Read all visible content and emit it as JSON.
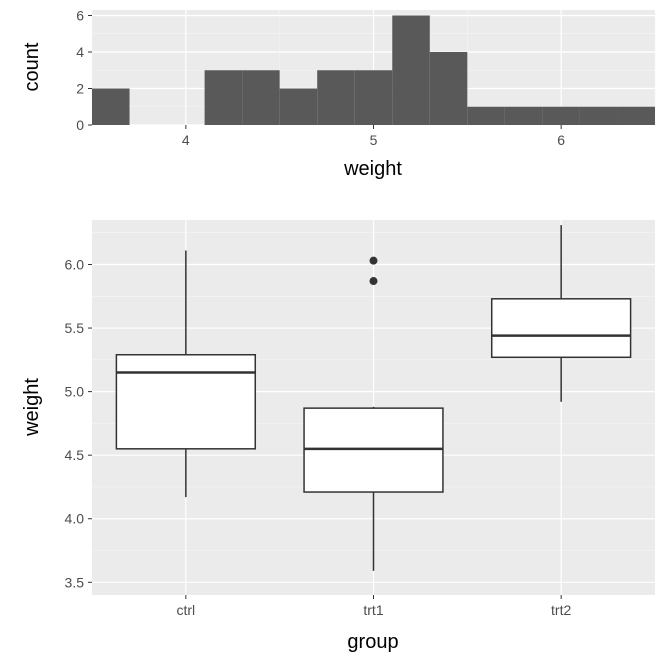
{
  "chart_data": [
    {
      "type": "bar",
      "xlabel": "weight",
      "ylabel": "count",
      "x_ticks": [
        4,
        5,
        6
      ],
      "y_ticks": [
        0,
        2,
        4,
        6
      ],
      "xlim": [
        3.5,
        6.5
      ],
      "ylim": [
        0,
        6.3
      ],
      "bin_width": 0.2,
      "categories": [
        3.6,
        3.8,
        4.0,
        4.2,
        4.4,
        4.6,
        4.8,
        5.0,
        5.2,
        5.4,
        5.6,
        5.8,
        6.0,
        6.2,
        6.4
      ],
      "values": [
        2,
        0,
        0,
        3,
        3,
        2,
        3,
        3,
        6,
        4,
        1,
        1,
        1,
        1,
        1
      ]
    },
    {
      "type": "box",
      "xlabel": "group",
      "ylabel": "weight",
      "y_ticks": [
        3.5,
        4.0,
        4.5,
        5.0,
        5.5,
        6.0
      ],
      "ylim": [
        3.4,
        6.35
      ],
      "categories": [
        "ctrl",
        "trt1",
        "trt2"
      ],
      "series": [
        {
          "name": "ctrl",
          "min": 4.17,
          "q1": 4.55,
          "median": 5.15,
          "q3": 5.29,
          "max": 6.11,
          "outliers": []
        },
        {
          "name": "trt1",
          "min": 3.59,
          "q1": 4.21,
          "median": 4.55,
          "q3": 4.87,
          "max": 4.88,
          "outliers": [
            5.87,
            6.03
          ]
        },
        {
          "name": "trt2",
          "min": 4.92,
          "q1": 5.27,
          "median": 5.44,
          "q3": 5.73,
          "max": 6.31,
          "outliers": []
        }
      ]
    }
  ]
}
